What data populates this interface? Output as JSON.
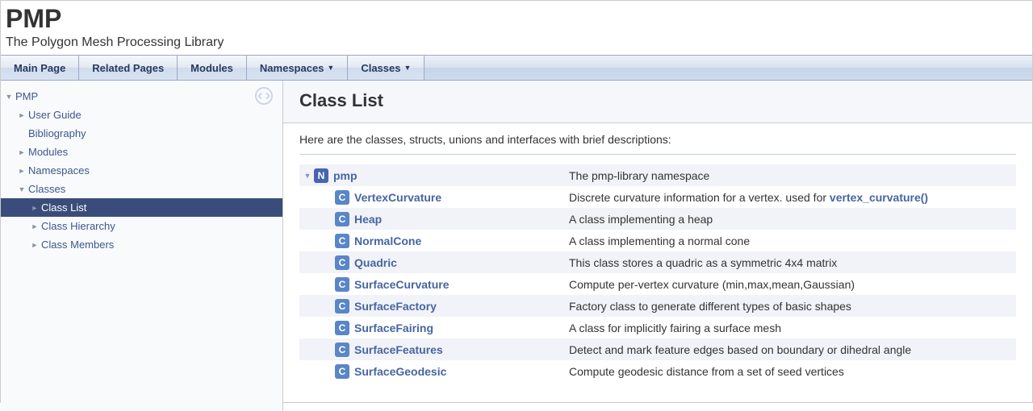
{
  "header": {
    "project_name": "PMP",
    "project_brief": "The Polygon Mesh Processing Library"
  },
  "tabs": [
    {
      "label": "Main Page",
      "dropdown": false
    },
    {
      "label": "Related Pages",
      "dropdown": false
    },
    {
      "label": "Modules",
      "dropdown": false
    },
    {
      "label": "Namespaces",
      "dropdown": true
    },
    {
      "label": "Classes",
      "dropdown": true
    }
  ],
  "sidebar": {
    "items": [
      {
        "label": "PMP",
        "indent": 0,
        "arrow": "down",
        "active": false
      },
      {
        "label": "User Guide",
        "indent": 1,
        "arrow": "right",
        "active": false
      },
      {
        "label": "Bibliography",
        "indent": 1,
        "arrow": "none",
        "active": false
      },
      {
        "label": "Modules",
        "indent": 1,
        "arrow": "right",
        "active": false
      },
      {
        "label": "Namespaces",
        "indent": 1,
        "arrow": "right",
        "active": false
      },
      {
        "label": "Classes",
        "indent": 1,
        "arrow": "down",
        "active": false
      },
      {
        "label": "Class List",
        "indent": 2,
        "arrow": "right",
        "active": true
      },
      {
        "label": "Class Hierarchy",
        "indent": 2,
        "arrow": "right",
        "active": false
      },
      {
        "label": "Class Members",
        "indent": 2,
        "arrow": "right",
        "active": false
      }
    ]
  },
  "content": {
    "title": "Class List",
    "intro": "Here are the classes, structs, unions and interfaces with brief descriptions:",
    "rows": [
      {
        "arrow": "down",
        "indent": 0,
        "badge": "N",
        "name": "pmp",
        "desc": "The pmp-library namespace",
        "alt": true
      },
      {
        "arrow": "none",
        "indent": 1,
        "badge": "C",
        "name": "VertexCurvature",
        "desc": "Discrete curvature information for a vertex. used for ",
        "link": "vertex_curvature()",
        "alt": false
      },
      {
        "arrow": "none",
        "indent": 1,
        "badge": "C",
        "name": "Heap",
        "desc": "A class implementing a heap",
        "alt": true
      },
      {
        "arrow": "none",
        "indent": 1,
        "badge": "C",
        "name": "NormalCone",
        "desc": "A class implementing a normal cone",
        "alt": false
      },
      {
        "arrow": "none",
        "indent": 1,
        "badge": "C",
        "name": "Quadric",
        "desc": "This class stores a quadric as a symmetric 4x4 matrix",
        "alt": true
      },
      {
        "arrow": "none",
        "indent": 1,
        "badge": "C",
        "name": "SurfaceCurvature",
        "desc": "Compute per-vertex curvature (min,max,mean,Gaussian)",
        "alt": false
      },
      {
        "arrow": "none",
        "indent": 1,
        "badge": "C",
        "name": "SurfaceFactory",
        "desc": "Factory class to generate different types of basic shapes",
        "alt": true
      },
      {
        "arrow": "none",
        "indent": 1,
        "badge": "C",
        "name": "SurfaceFairing",
        "desc": "A class for implicitly fairing a surface mesh",
        "alt": false
      },
      {
        "arrow": "none",
        "indent": 1,
        "badge": "C",
        "name": "SurfaceFeatures",
        "desc": "Detect and mark feature edges based on boundary or dihedral angle",
        "alt": true
      },
      {
        "arrow": "none",
        "indent": 1,
        "badge": "C",
        "name": "SurfaceGeodesic",
        "desc": "Compute geodesic distance from a set of seed vertices",
        "alt": false
      }
    ]
  }
}
